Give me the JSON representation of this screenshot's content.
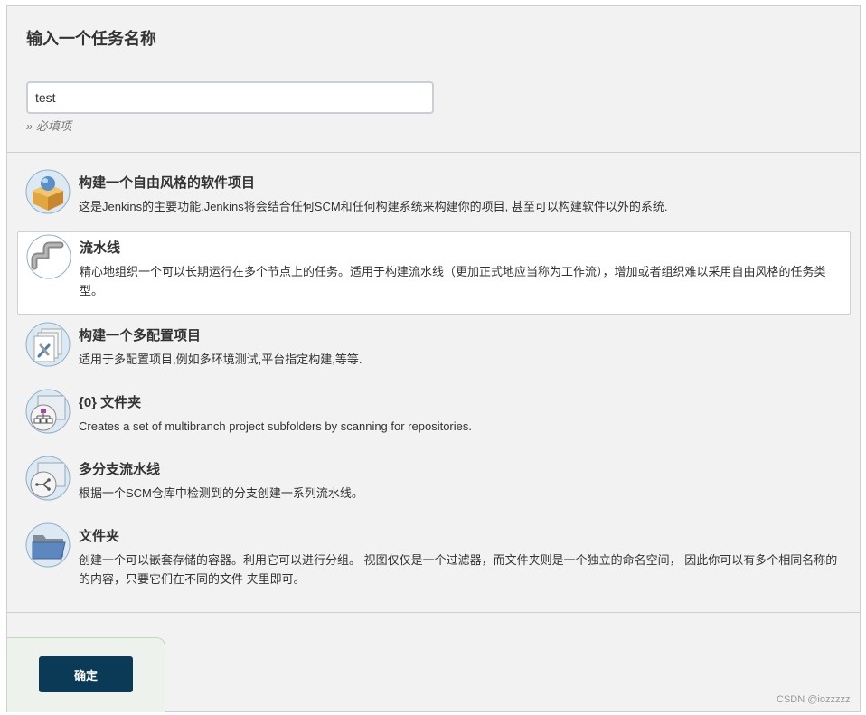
{
  "header": {
    "title": "输入一个任务名称",
    "name_value": "test",
    "required_note": "» 必填项"
  },
  "items": [
    {
      "title": "构建一个自由风格的软件项目",
      "description": "这是Jenkins的主要功能.Jenkins将会结合任何SCM和任何构建系统来构建你的项目, 甚至可以构建软件以外的系统.",
      "icon": "freestyle-box-icon",
      "selected": false
    },
    {
      "title": "流水线",
      "description": "精心地组织一个可以长期运行在多个节点上的任务。适用于构建流水线（更加正式地应当称为工作流），增加或者组织难以采用自由风格的任务类型。",
      "icon": "pipe-icon",
      "selected": true
    },
    {
      "title": "构建一个多配置项目",
      "description": "适用于多配置项目,例如多环境测试,平台指定构建,等等.",
      "icon": "multi-config-icon",
      "selected": false
    },
    {
      "title": "{0} 文件夹",
      "description": "Creates a set of multibranch project subfolders by scanning for repositories.",
      "icon": "org-folder-icon",
      "selected": false
    },
    {
      "title": "多分支流水线",
      "description": "根据一个SCM仓库中检测到的分支创建一系列流水线。",
      "icon": "multibranch-icon",
      "selected": false
    },
    {
      "title": "文件夹",
      "description": "创建一个可以嵌套存储的容器。利用它可以进行分组。 视图仅仅是一个过滤器，而文件夹则是一个独立的命名空间， 因此你可以有多个相同名称的的内容，只要它们在不同的文件 夹里即可。",
      "icon": "folder-icon",
      "selected": false
    }
  ],
  "footer": {
    "confirm_label": "确定"
  },
  "watermark": "CSDN @iozzzzz",
  "colors": {
    "confirm_button": "#0b3a57",
    "panel_bg": "#f2f2f2",
    "input_border": "#c9cfd4"
  }
}
